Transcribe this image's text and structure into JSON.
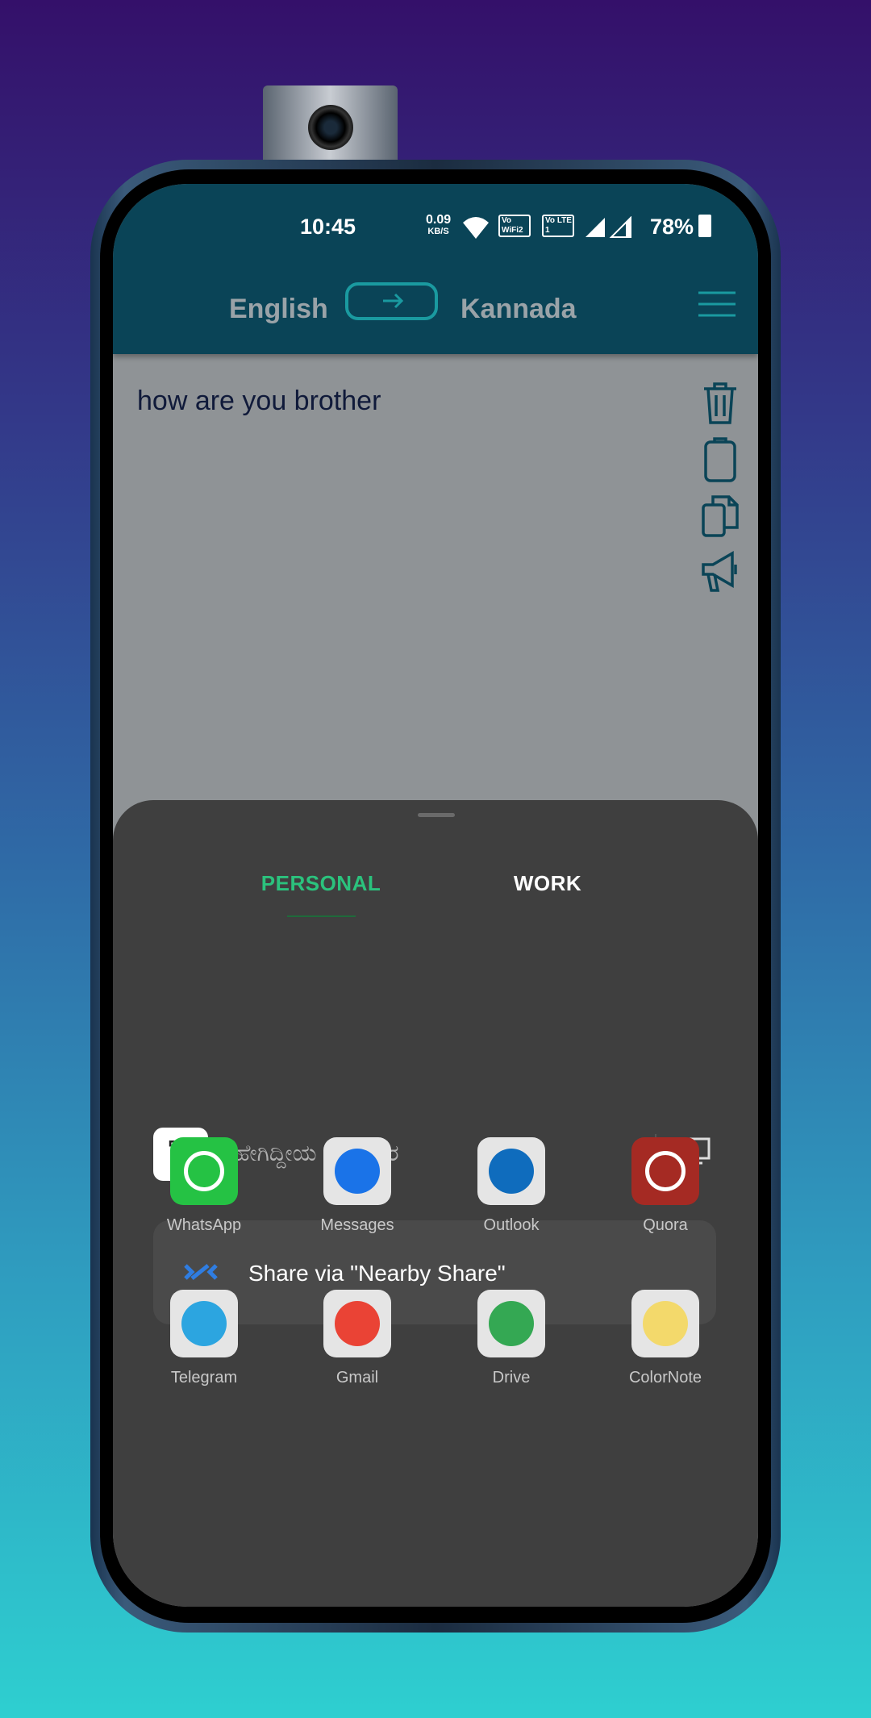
{
  "status": {
    "time": "10:45",
    "net_speed": "0.09",
    "net_unit": "KB/S",
    "vowifi": "Vo WiFi 2",
    "volte": "Vo LTE 1",
    "battery": "78%"
  },
  "header": {
    "source_lang": "English",
    "target_lang": "Kannada",
    "swap_icon": "arrow-right-icon",
    "menu_icon": "hamburger-icon"
  },
  "content": {
    "input_text": "how are you brother",
    "icons": [
      "trash-icon",
      "clipboard-icon",
      "copy-icon",
      "megaphone-icon"
    ]
  },
  "sheet": {
    "tabs": [
      {
        "label": "PERSONAL",
        "active": true
      },
      {
        "label": "WORK",
        "active": false
      }
    ],
    "preview_text": "ಹೇಗಿದ್ದೀಯ ಸಹೋದರ",
    "nearby_label": "Share via \"Nearby Share\"",
    "apps": [
      {
        "label": "WhatsApp",
        "color": "#25c244"
      },
      {
        "label": "Messages",
        "color": "#1a73e8"
      },
      {
        "label": "Outlook",
        "color": "#0f6cbd"
      },
      {
        "label": "Quora",
        "color": "#a52a23"
      },
      {
        "label": "Telegram",
        "color": "#2ca5e0"
      },
      {
        "label": "Gmail",
        "color": "#ea4335"
      },
      {
        "label": "Drive",
        "color": "#34a853"
      },
      {
        "label": "ColorNote",
        "color": "#f3d96b"
      }
    ],
    "page_dots": 3,
    "active_page": 1
  },
  "colors": {
    "accent_tab": "#2bc27d",
    "header_bg": "#0a4457",
    "teal": "#1a9aa0"
  }
}
